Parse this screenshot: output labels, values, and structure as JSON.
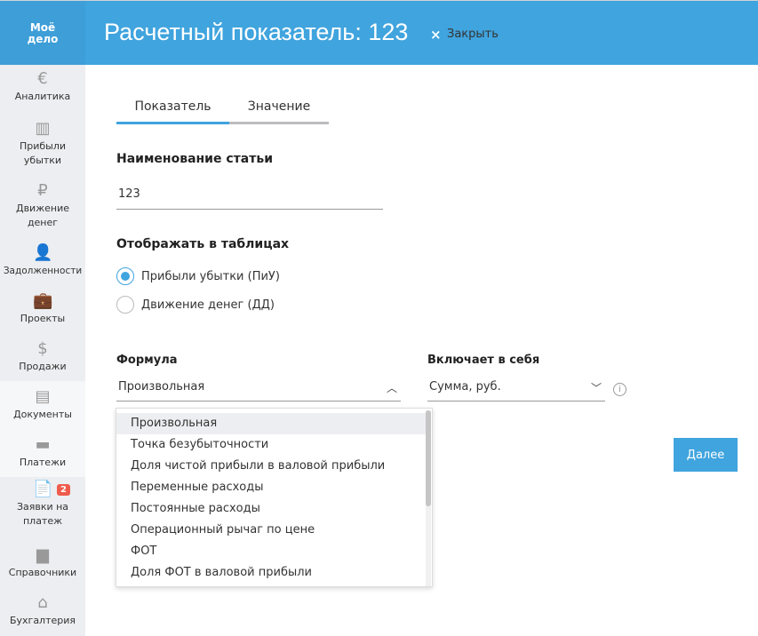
{
  "logo": {
    "line1": "Моё",
    "line2": "дело"
  },
  "header": {
    "title": "Расчетный показатель: 123",
    "close_label": "Закрыть"
  },
  "sidebar": {
    "items": [
      {
        "label": "Аналитика",
        "icon": "€"
      },
      {
        "label": "Прибыли убытки",
        "icon": "▥"
      },
      {
        "label": "Движение денег",
        "icon": "₽"
      },
      {
        "label": "Задолженности",
        "icon": "👤"
      },
      {
        "label": "Проекты",
        "icon": "💼"
      },
      {
        "label": "Продажи",
        "icon": "$"
      },
      {
        "label": "Документы",
        "icon": "▤"
      },
      {
        "label": "Платежи",
        "icon": "▬"
      },
      {
        "label": "Заявки на платеж",
        "icon": "📄",
        "badge": "2"
      },
      {
        "label": "Справочники",
        "icon": "▆"
      },
      {
        "label": "Бухгалтерия",
        "icon": "⌂"
      }
    ]
  },
  "tabs": [
    "Показатель",
    "Значение"
  ],
  "form": {
    "name_label": "Наименование статьи",
    "name_value": "123",
    "show_label": "Отображать в таблицах",
    "radios": [
      "Прибыли убытки (ПиУ)",
      "Движение денег (ДД)"
    ],
    "formula_label": "Формула",
    "formula_value": "Произвольная",
    "includes_label": "Включает в себя",
    "includes_value": "Сумма, руб.",
    "next_button": "Далее"
  },
  "dropdown": [
    "Произвольная",
    "Точка безубыточности",
    "Доля чистой прибыли в валовой прибыли",
    "Переменные расходы",
    "Постоянные расходы",
    "Операционный рычаг по цене",
    "ФОТ",
    "Доля ФОТ в валовой прибыли"
  ]
}
